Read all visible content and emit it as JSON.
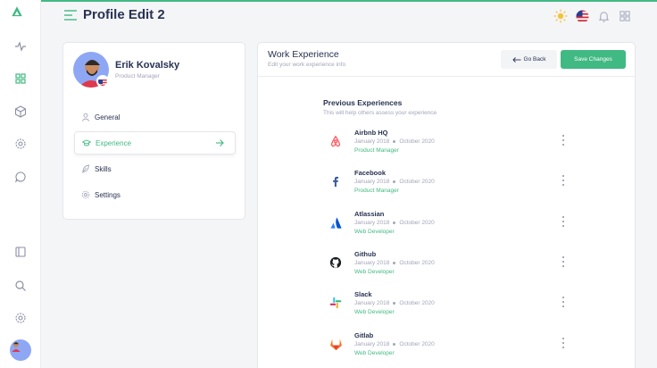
{
  "header": {
    "title": "Profile Edit 2"
  },
  "profile": {
    "name": "Erik Kovalsky",
    "role": "Product Manager"
  },
  "menu": [
    {
      "label": "General",
      "icon": "user-icon"
    },
    {
      "label": "Experience",
      "icon": "graduation-cap-icon",
      "active": true
    },
    {
      "label": "Skills",
      "icon": "feather-icon"
    },
    {
      "label": "Settings",
      "icon": "gear-icon"
    }
  ],
  "panel": {
    "title": "Work Experience",
    "subtitle": "Edit your work experience info",
    "back_label": "Go Back",
    "save_label": "Save Changes"
  },
  "section": {
    "title": "Previous Experiences",
    "subtitle": "This will help others assess your experience"
  },
  "experiences": [
    {
      "company": "Airbnb HQ",
      "start": "January 2018",
      "end": "October 2020",
      "role": "Product Manager",
      "logo": "airbnb-logo"
    },
    {
      "company": "Facebook",
      "start": "January 2018",
      "end": "October 2020",
      "role": "Product Manager",
      "logo": "facebook-logo"
    },
    {
      "company": "Atlassian",
      "start": "January 2018",
      "end": "October 2020",
      "role": "Web Developer",
      "logo": "atlassian-logo"
    },
    {
      "company": "Github",
      "start": "January 2018",
      "end": "October 2020",
      "role": "Web Developer",
      "logo": "github-logo"
    },
    {
      "company": "Slack",
      "start": "January 2018",
      "end": "October 2020",
      "role": "Web Developer",
      "logo": "slack-logo"
    },
    {
      "company": "Gitlab",
      "start": "January 2018",
      "end": "October 2020",
      "role": "Web Developer",
      "logo": "gitlab-logo"
    }
  ],
  "colors": {
    "accent": "#41b983",
    "text": "#283252",
    "muted": "#a2a5b9"
  }
}
